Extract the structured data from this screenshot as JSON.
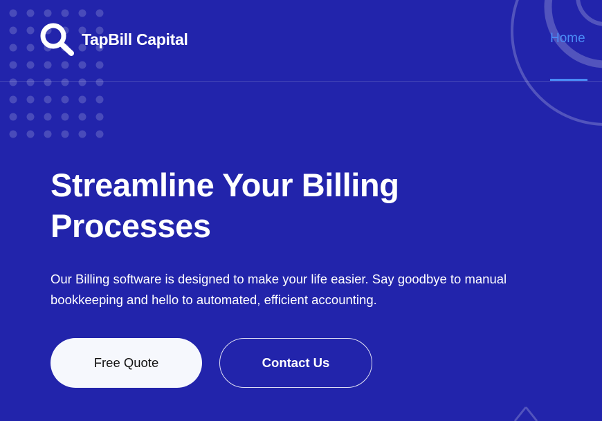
{
  "brand": {
    "name": "TapBill Capital",
    "logo_icon": "search-icon"
  },
  "nav": {
    "items": [
      {
        "label": "Home",
        "active": true
      }
    ]
  },
  "hero": {
    "title": "Streamline Your Billing Processes",
    "description": "Our Billing software is designed to make your life easier. Say goodbye to manual bookkeeping and hello to automated, efficient accounting.",
    "primary_button": "Free Quote",
    "secondary_button": "Contact Us"
  },
  "colors": {
    "background": "#2224ab",
    "accent": "#4a8bf6",
    "primary_button_bg": "#f6f8fd",
    "text": "#ffffff"
  }
}
